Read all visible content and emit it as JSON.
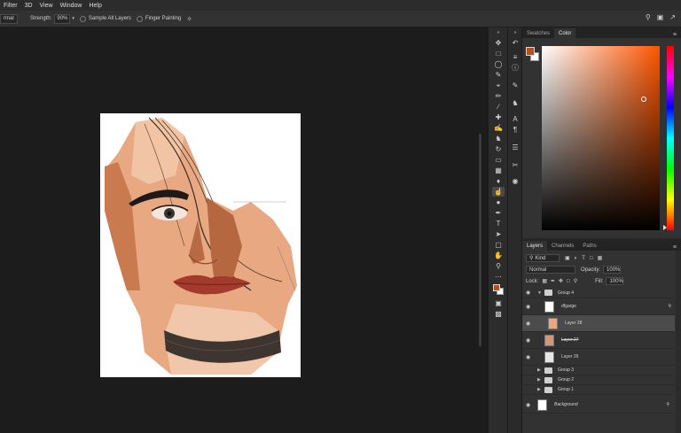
{
  "menu": {
    "items": [
      "Filter",
      "3D",
      "View",
      "Window",
      "Help"
    ]
  },
  "options": {
    "mode_value": "rmal",
    "strength_label": "Strength:",
    "strength_value": "90%",
    "sample_all_layers": "Sample All Layers",
    "finger_painting": "Finger Painting"
  },
  "colors": {
    "foreground": "#b5511f",
    "background": "#ffffff",
    "hue": "#ff5500"
  },
  "color_panel": {
    "tabs": [
      "Swatches",
      "Color"
    ],
    "active_tab": "Color"
  },
  "layers_panel": {
    "tabs": [
      "Layers",
      "Channels",
      "Paths"
    ],
    "active_tab": "Layers",
    "kind_label": "Kind",
    "blend_mode": "Normal",
    "opacity_label": "Opacity:",
    "opacity_value": "100%",
    "lock_label": "Lock:",
    "fill_label": "Fill:",
    "fill_value": "100%",
    "layers": [
      {
        "name": "Group 4",
        "type": "group",
        "visible": true,
        "expanded": true
      },
      {
        "name": "dfgarge",
        "type": "layer",
        "visible": true
      },
      {
        "name": "Layer 28",
        "type": "layer",
        "visible": true,
        "selected": true
      },
      {
        "name": "Layer 27",
        "type": "layer",
        "visible": true
      },
      {
        "name": "Layer 26",
        "type": "layer",
        "visible": true
      },
      {
        "name": "Group 3",
        "type": "group",
        "visible": false
      },
      {
        "name": "Group 2",
        "type": "group",
        "visible": false
      },
      {
        "name": "Group 1",
        "type": "group",
        "visible": false
      },
      {
        "name": "Background",
        "type": "background",
        "visible": true,
        "locked": true
      }
    ]
  }
}
